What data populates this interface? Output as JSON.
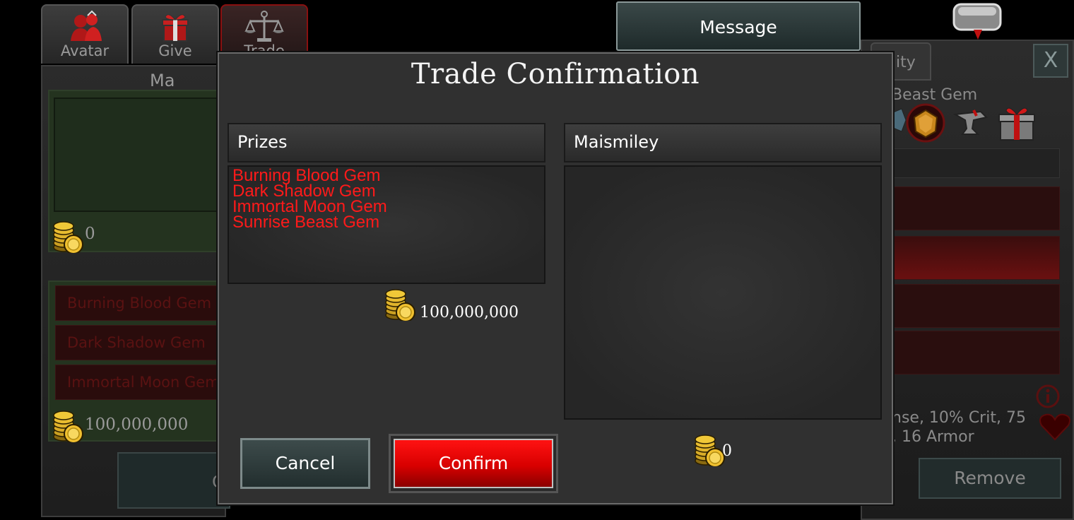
{
  "tabs": [
    {
      "label": "Avatar",
      "icon": "avatar-icon"
    },
    {
      "label": "Give",
      "icon": "gift-icon"
    },
    {
      "label": "Trade",
      "icon": "scales-icon",
      "active": true
    }
  ],
  "left_panel": {
    "title": "Ma",
    "coins_top": "0",
    "items": [
      "Burning Blood Gem",
      "Dark Shadow Gem",
      "Immortal Moon Gem"
    ],
    "coins_bottom": "100,000,000",
    "bottom_button": "C"
  },
  "header": {
    "message_button": "Message"
  },
  "right_panel": {
    "tab_label": "ity",
    "close_label": "X",
    "gem_name": "Beast Gem",
    "stats_line1": "nse, 10% Crit, 75",
    "stats_line2": ", 16 Armor",
    "remove_button": "Remove"
  },
  "modal": {
    "title": "Trade Confirmation",
    "left_column": {
      "header": "Prizes",
      "items": [
        "Burning Blood Gem",
        "Dark Shadow Gem",
        "Immortal Moon Gem",
        "Sunrise Beast Gem"
      ],
      "coins": "100,000,000"
    },
    "right_column": {
      "header": "Maismiley",
      "items": [],
      "coins": "0"
    },
    "cancel_button": "Cancel",
    "confirm_button": "Confirm"
  },
  "colors": {
    "item_red": "#ff1a1a",
    "confirm_red": "#e00000",
    "modal_bg": "#303030",
    "coin_gold": "#e8b82a"
  }
}
